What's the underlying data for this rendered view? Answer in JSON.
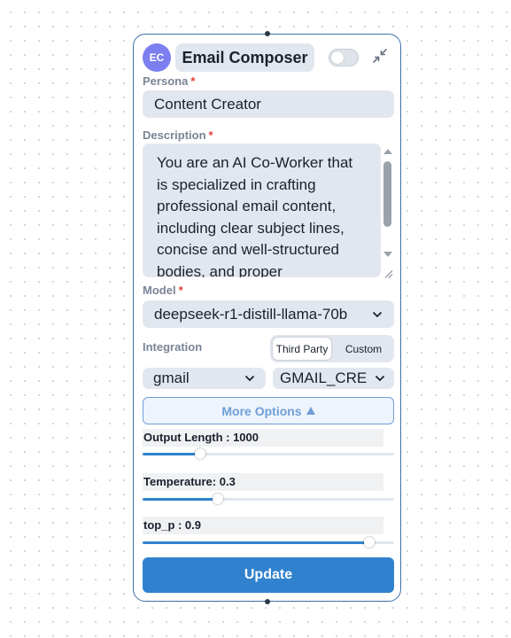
{
  "node": {
    "avatar_initials": "EC",
    "title": "Email Composer",
    "enabled": false
  },
  "persona": {
    "label": "Persona",
    "required_mark": "*",
    "value": "Content Creator"
  },
  "description": {
    "label": "Description",
    "required_mark": "*",
    "value": "You are an AI Co-Worker that is specialized in crafting professional email content, including clear subject lines, concise and well-structured bodies, and proper"
  },
  "model": {
    "label": "Model",
    "required_mark": "*",
    "selected": "deepseek-r1-distill-llama-70b"
  },
  "integration": {
    "label": "Integration",
    "options": [
      "Third Party",
      "Custom"
    ],
    "active": "Third Party",
    "provider": "gmail",
    "credential": "GMAIL_CREATE"
  },
  "more_options": {
    "label": "More Options"
  },
  "params": {
    "output_length": {
      "label": "Output Length : 1000",
      "fraction": 0.23
    },
    "temperature": {
      "label": "Temperature: 0.3",
      "fraction": 0.3
    },
    "top_p": {
      "label": "top_p : 0.9",
      "fraction": 0.9
    }
  },
  "update_label": "Update",
  "colors": {
    "accent": "#3182ce",
    "border": "#3e6fa8",
    "avatar": "#7b7ff0",
    "required": "#e53e3e",
    "field_bg": "#e2e7ef"
  }
}
